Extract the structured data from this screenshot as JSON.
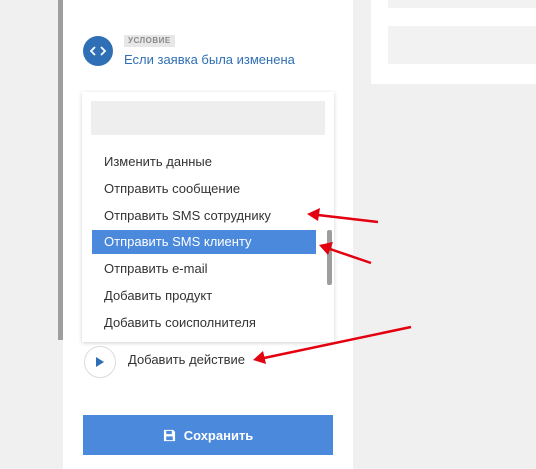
{
  "condition": {
    "badge": "УСЛОВИЕ",
    "title": "Если заявка была изменена",
    "icon": "code-brackets-icon"
  },
  "dropdown": {
    "search_placeholder": "",
    "options": [
      {
        "label": "Изменить данные",
        "selected": false
      },
      {
        "label": "Отправить сообщение",
        "selected": false
      },
      {
        "label": "Отправить SMS сотруднику",
        "selected": false
      },
      {
        "label": "Отправить SMS клиенту",
        "selected": true
      },
      {
        "label": "Отправить e-mail",
        "selected": false
      },
      {
        "label": "Добавить продукт",
        "selected": false
      },
      {
        "label": "Добавить соисполнителя",
        "selected": false
      }
    ]
  },
  "add_action": {
    "label": "Добавить действие",
    "icon": "play-icon"
  },
  "save": {
    "label": "Сохранить",
    "icon": "floppy-disk-icon"
  },
  "colors": {
    "accent": "#4a89dc",
    "condition_blue": "#2f6fb6",
    "annotation_arrow": "#e3000f"
  }
}
